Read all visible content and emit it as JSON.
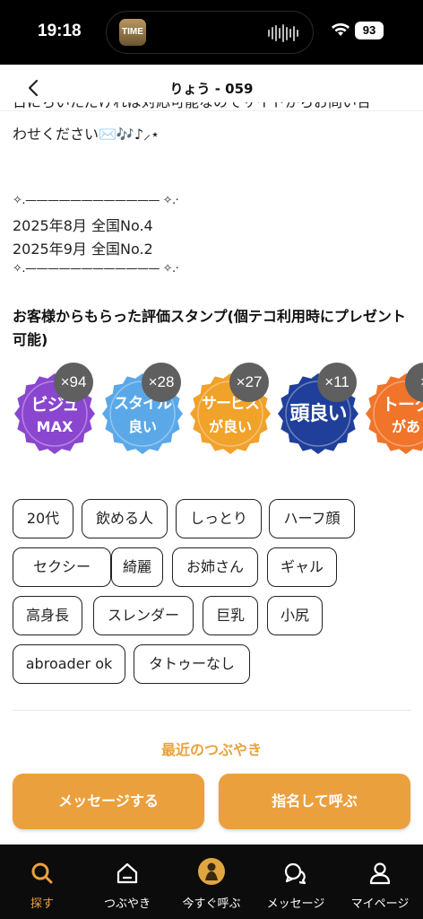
{
  "status_bar": {
    "time": "19:18",
    "app_badge": "TIME",
    "battery": "93"
  },
  "header": {
    "title": "りょう - 059"
  },
  "bio": {
    "cut_line": "日にちいただければ対応可能なのでサイトからお問い合",
    "line1": "わせください✉️🎶♪⸝⋆"
  },
  "separator": "✧.———————————— ✧.·",
  "ranks": [
    "2025年8月 全国No.4",
    "2025年9月 全国No.2"
  ],
  "stamps_title": "お客様からもらった評価スタンプ(個テコ利用時にプレゼント可能)",
  "stamps": [
    {
      "line1": "ビジュ",
      "line2": "MAX",
      "count": "×94",
      "color": "#8a46cf"
    },
    {
      "line1": "スタイル",
      "line2": "良い",
      "count": "×28",
      "color": "#5ba8e8"
    },
    {
      "line1": "サービス",
      "line2": "が良い",
      "count": "×27",
      "color": "#f0a22a"
    },
    {
      "line1": "頭良い",
      "line2": "",
      "count": "×11",
      "color": "#1f3f9a"
    },
    {
      "line1": "トーク",
      "line2": "があ",
      "count": "×",
      "color": "#f0742a"
    }
  ],
  "tags": [
    "20代",
    "飲める人",
    "しっとり",
    "ハーフ顔",
    "セクシー",
    "綺麗",
    "お姉さん",
    "ギャル",
    "高身長",
    "スレンダー",
    "巨乳",
    "小尻",
    "abroader ok",
    "タトゥーなし"
  ],
  "recent_link": "最近のつぶやき",
  "buttons": {
    "message": "メッセージする",
    "nominate": "指名して呼ぶ"
  },
  "tabs": [
    {
      "label": "探す",
      "icon": "search-icon",
      "active": true
    },
    {
      "label": "つぶやき",
      "icon": "home-icon",
      "active": false
    },
    {
      "label": "今すぐ呼ぶ",
      "icon": "call-now-icon",
      "active": false
    },
    {
      "label": "メッセージ",
      "icon": "chat-icon",
      "active": false
    },
    {
      "label": "マイページ",
      "icon": "user-icon",
      "active": false
    }
  ],
  "colors": {
    "accent": "#eba03e",
    "tabbar": "#0c0c0c"
  }
}
